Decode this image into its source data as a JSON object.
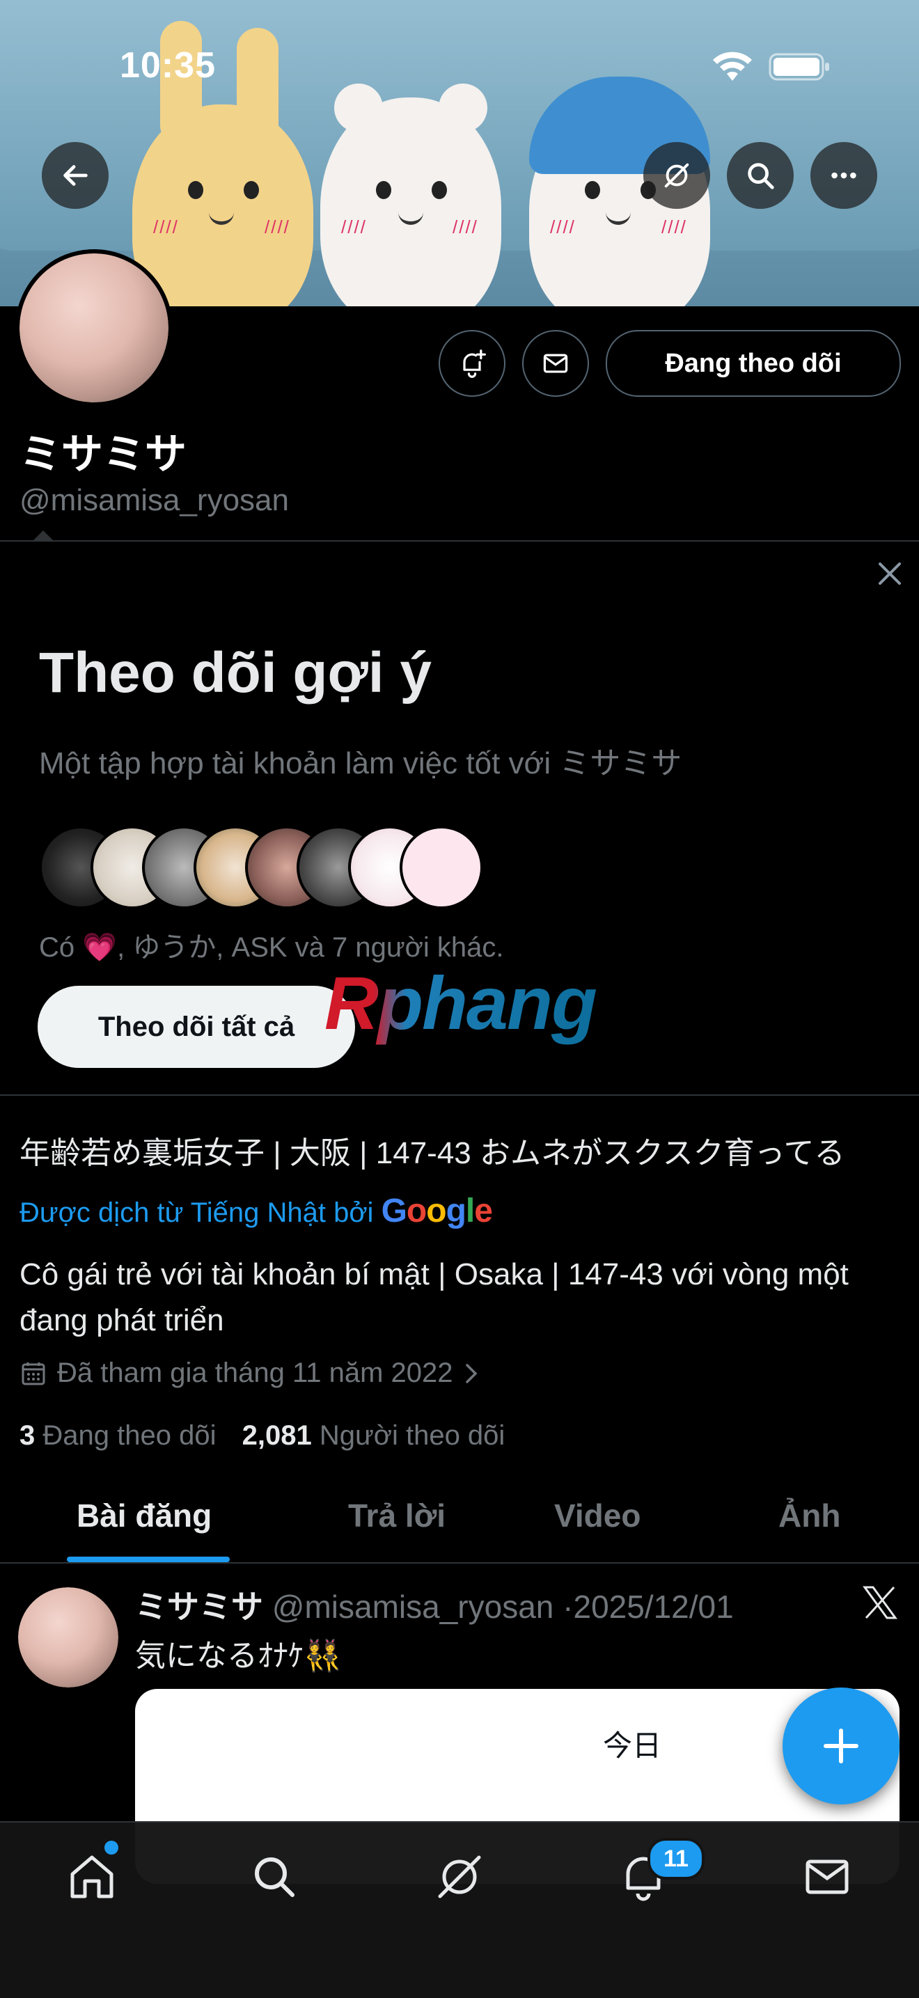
{
  "status_bar": {
    "time": "10:35"
  },
  "profile": {
    "display_name": "ミサミサ",
    "handle": "@misamisa_ryosan",
    "following_button": "Đang theo dõi",
    "bio_original": "年齢若め裏垢女子 | 大阪 | 147-43 おムネがスクスク育ってる",
    "translated_by": "Được dịch từ Tiếng Nhật bởi",
    "translator_brand": "Google",
    "bio_translated": "Cô gái trẻ với tài khoản bí mật | Osaka | 147-43 với vòng một đang phát triển",
    "joined": "Đã tham gia tháng 11 năm 2022",
    "following_count": "3",
    "following_label": "Đang theo dõi",
    "followers_count": "2,081",
    "followers_label": "Người theo dõi"
  },
  "suggestion": {
    "title": "Theo dõi gợi ý",
    "subtitle": "Một tập hợp tài khoản làm việc tốt với ミサミサ",
    "followers_text_prefix": "Có",
    "followers_text_emoji": "💗",
    "followers_text_rest": ", ゆうか, ASK và 7 người khác.",
    "follow_all_button": "Theo dõi tất cả"
  },
  "watermark": "Rphang",
  "tabs": [
    {
      "label": "Bài đăng",
      "active": true
    },
    {
      "label": "Trả lời",
      "active": false
    },
    {
      "label": "Video",
      "active": false
    },
    {
      "label": "Ảnh",
      "active": false
    }
  ],
  "post": {
    "name": "ミサミサ",
    "handle": "@misamisa_ryosan",
    "separator": "·",
    "date": "2025/12/01",
    "text": "気になるｵﾅｹ👯",
    "card_label": "今日"
  },
  "bottom_nav": {
    "items": [
      "home-icon",
      "search-icon",
      "grok-icon",
      "notifications-icon",
      "messages-icon"
    ],
    "notification_count": "11"
  },
  "colors": {
    "accent": "#1d9bf0",
    "background": "#000000",
    "muted": "#71767b"
  }
}
